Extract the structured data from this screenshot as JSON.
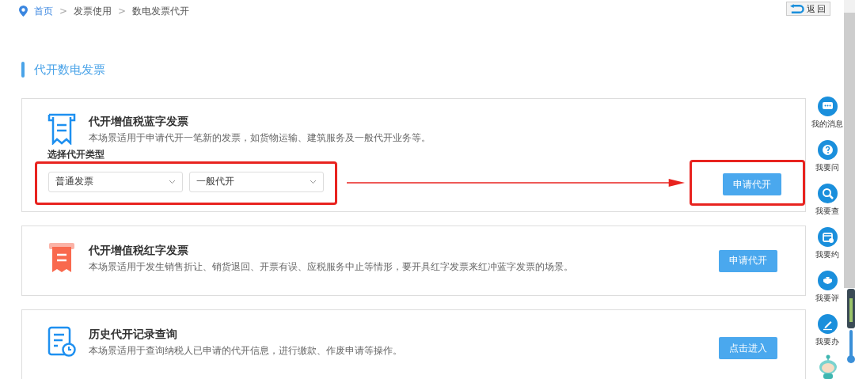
{
  "breadcrumb": [
    {
      "label": "首页",
      "kind": "home"
    },
    {
      "prefix": ">",
      "label": "发票使用",
      "kind": "link"
    },
    {
      "prefix": ">",
      "label": "数电发票代开",
      "kind": "current"
    }
  ],
  "back_button": {
    "label": "返回"
  },
  "section_title": "代开数电发票",
  "cards": [
    {
      "kind": "blue",
      "title": "代开增值税蓝字发票",
      "description": "本场景适用于申请代开一笔新的发票，如货物运输、建筑服务及一般代开业务等。",
      "form": {
        "label": "选择代开类型",
        "highlighted": true,
        "selects": [
          {
            "value": "普通发票"
          },
          {
            "value": "一般代开"
          }
        ]
      },
      "arrow": true,
      "button": {
        "label": "申请代开",
        "highlighted": true
      }
    },
    {
      "kind": "red",
      "title": "代开增值税红字发票",
      "description": "本场景适用于发生销售折让、销货退回、开票有误、应税服务中止等情形，要开具红字发票来红冲蓝字发票的场景。",
      "button": {
        "label": "申请代开"
      }
    },
    {
      "kind": "history",
      "title": "历史代开记录查询",
      "description": "本场景适用于查询纳税人已申请的代开信息，进行缴款、作废申请等操作。",
      "button": {
        "label": "点击进入"
      }
    }
  ],
  "sidebar": [
    {
      "label": "我的消息",
      "kind": "message"
    },
    {
      "label": "我要问",
      "kind": "question"
    },
    {
      "label": "我要查",
      "kind": "search"
    },
    {
      "label": "我要约",
      "kind": "calendar"
    },
    {
      "label": "我要评",
      "kind": "rate"
    },
    {
      "label": "我要办",
      "kind": "edit"
    }
  ]
}
